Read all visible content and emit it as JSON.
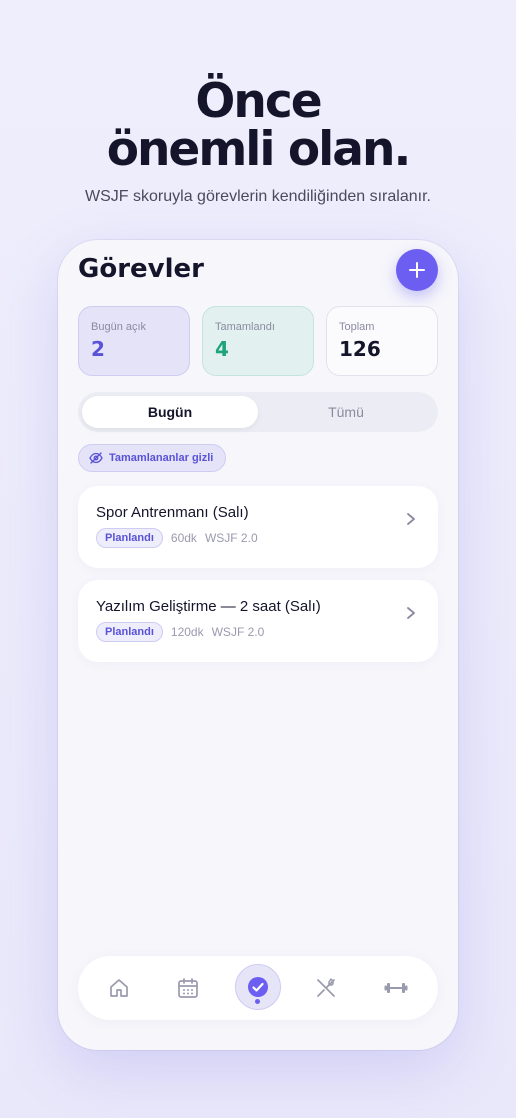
{
  "hero": {
    "title_line1": "Önce",
    "title_line2": "önemli olan.",
    "subtitle": "WSJF skoruyla görevlerin kendiliğinden sıralanır."
  },
  "app": {
    "title": "Görevler"
  },
  "stats": [
    {
      "label": "Bugün açık",
      "value": "2"
    },
    {
      "label": "Tamamlandı",
      "value": "4"
    },
    {
      "label": "Toplam",
      "value": "126"
    }
  ],
  "segments": {
    "active": "Bugün",
    "inactive": "Tümü"
  },
  "filter_chip": {
    "label": "Tamamlananlar gizli",
    "icon": "eye-off-icon"
  },
  "tasks": [
    {
      "title": "Spor Antrenmanı (Salı)",
      "status": "Planlandı",
      "duration": "60dk",
      "wsjf": "WSJF 2.0"
    },
    {
      "title": "Yazılım Geliştirme — 2 saat (Salı)",
      "status": "Planlandı",
      "duration": "120dk",
      "wsjf": "WSJF 2.0"
    }
  ],
  "tabbar": {
    "items": [
      "home-icon",
      "calendar-icon",
      "check-circle-icon",
      "utensils-icon",
      "dumbbell-icon"
    ],
    "active": "check-circle-icon"
  },
  "colors": {
    "accent": "#6b5ef0",
    "done": "#1fa37a",
    "background": "#efeefc"
  }
}
